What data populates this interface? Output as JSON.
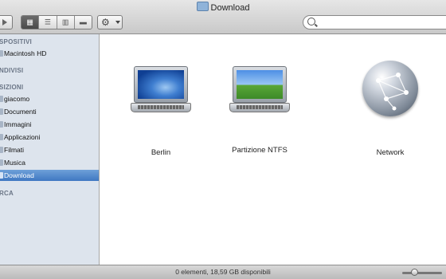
{
  "window": {
    "title": "Download",
    "title_icon": "folder-icon"
  },
  "toolbar": {
    "back_forward_icon": "play-triangle-icon",
    "views": [
      {
        "name": "icon-view",
        "glyph": "▦"
      },
      {
        "name": "list-view",
        "glyph": "☰"
      },
      {
        "name": "column-view",
        "glyph": "▥"
      },
      {
        "name": "coverflow-view",
        "glyph": "▬"
      }
    ],
    "action_icon": "gear-icon",
    "action_glyph": "⚙",
    "search_icon": "magnifier-icon",
    "search_value": ""
  },
  "sidebar": {
    "sections": [
      {
        "label": "DISPOSITIVI",
        "display": "SPOSITIVI"
      },
      {
        "label": "CONDIVISI",
        "display": "NDIVISI"
      },
      {
        "label": "POSIZIONI",
        "display": "SIZIONI"
      },
      {
        "label": "CERCA",
        "display": "RCA"
      }
    ],
    "items": [
      {
        "label": "Macintosh HD"
      },
      {
        "label": "giacomo"
      },
      {
        "label": "Documenti"
      },
      {
        "label": "Immagini"
      },
      {
        "label": "Applicazioni"
      },
      {
        "label": "Filmati"
      },
      {
        "label": "Musica"
      },
      {
        "label": "Download",
        "selected": true
      }
    ],
    "selected_color": "#3f78c2"
  },
  "main": {
    "items": [
      {
        "label": "Berlin",
        "icon": "laptop-icon"
      },
      {
        "label": "Partizione NTFS",
        "icon": "laptop-icon"
      },
      {
        "label": "Network",
        "icon": "network-globe-icon"
      }
    ]
  },
  "status": {
    "text": "0 elementi, 18,59 GB disponibili"
  }
}
